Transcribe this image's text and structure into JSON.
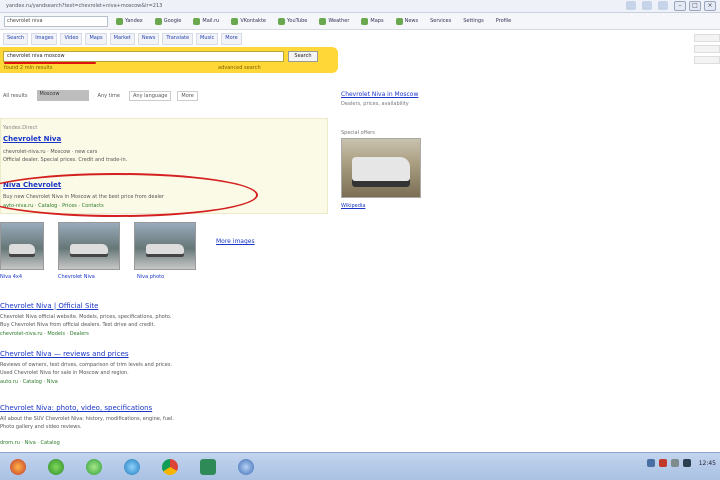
{
  "browser": {
    "url": "yandex.ru/yandsearch?text=chevrolet+niva+moscow&lr=213",
    "win_minimize": "–",
    "win_maximize": "□",
    "win_close": "×"
  },
  "bookmarks": {
    "search_box": "chevrolet niva",
    "items": [
      "Yandex",
      "Google",
      "Mail.ru",
      "VKontakte",
      "YouTube",
      "Weather",
      "Maps",
      "News"
    ],
    "right_items": [
      "Services",
      "Settings",
      "Profile"
    ]
  },
  "services": [
    "Search",
    "Images",
    "Video",
    "Maps",
    "Market",
    "News",
    "Translate",
    "Music",
    "More"
  ],
  "search": {
    "query": "chevrolet niva moscow",
    "button": "Search",
    "sub_left": "found 2 mln results",
    "sub_right": "advanced search"
  },
  "filters": {
    "all": "All results",
    "active": "Moscow",
    "period": "Any time",
    "lang": "Any language",
    "more": "More"
  },
  "ad": {
    "caption": "Yandex.Direct",
    "first_title": "Chevrolet Niva",
    "first_line1": "chevrolet-niva.ru · Moscow · new cars",
    "first_line2": "Official dealer. Special prices. Credit and trade-in.",
    "second_title": "Niva Chevrolet",
    "second_line": "Buy new Chevrolet Niva in Moscow at the best price from dealer",
    "second_url": "avto-niva.ru · Catalog · Prices · Contacts"
  },
  "images": {
    "captions": [
      "Niva 4x4",
      "Chevrolet Niva",
      "Niva photo"
    ],
    "more": "More images"
  },
  "results": [
    {
      "title": "Chevrolet Niva | Official Site",
      "line1": "Chevrolet Niva official website. Models, prices, specifications, photo.",
      "line2": "Buy Chevrolet Niva from official dealers. Test drive and credit.",
      "url": "chevrolet-niva.ru · Models · Dealers"
    },
    {
      "title": "Chevrolet Niva — reviews and prices",
      "line1": "Reviews of owners, test drives, comparison of trim levels and prices.",
      "line2": "Used Chevrolet Niva for sale in Moscow and region.",
      "url": "auto.ru · Catalog · Niva"
    },
    {
      "title": "Chevrolet Niva: photo, video, specifications",
      "line1": "All about the SUV Chevrolet Niva: history, modifications, engine, fuel.",
      "line2": "Photo gallery and video reviews.",
      "url": "drom.ru · Niva · Catalog"
    }
  ],
  "right_col": {
    "title": "Chevrolet Niva in Moscow",
    "line1": "Dealers, prices, availability",
    "line2": "Special offers",
    "caption": "Wikipedia"
  },
  "taskbar": {
    "apps": [
      "firefox-app",
      "ie-app",
      "chrome-app",
      "skype-app",
      "folder-app",
      "excel-app",
      "network-app"
    ],
    "clock": "12:45"
  }
}
